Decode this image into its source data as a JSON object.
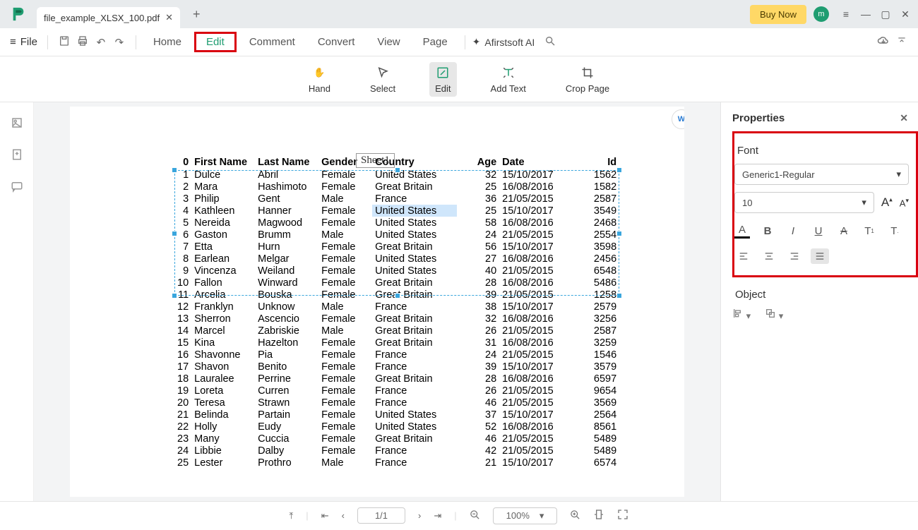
{
  "titlebar": {
    "filename": "file_example_XLSX_100.pdf",
    "buy": "Buy Now",
    "avatar": "m"
  },
  "menu": {
    "file": "File",
    "tabs": [
      "Home",
      "Edit",
      "Comment",
      "Convert",
      "View",
      "Page"
    ],
    "active": "Edit",
    "ai": "Afirstsoft AI"
  },
  "tools": {
    "hand": "Hand",
    "select": "Select",
    "edit": "Edit",
    "addtext": "Add Text",
    "croppage": "Crop Page"
  },
  "sheet_label": "Sheet1",
  "headers": [
    "",
    "First Name",
    "Last Name",
    "Gender",
    "Country",
    "Age",
    "Date",
    "Id"
  ],
  "rows": [
    [
      "0",
      "",
      "",
      "",
      "",
      "",
      "",
      ""
    ],
    [
      "1",
      "Dulce",
      "Abril",
      "Female",
      "United States",
      "32",
      "15/10/2017",
      "1562"
    ],
    [
      "2",
      "Mara",
      "Hashimoto",
      "Female",
      "Great Britain",
      "25",
      "16/08/2016",
      "1582"
    ],
    [
      "3",
      "Philip",
      "Gent",
      "Male",
      "France",
      "36",
      "21/05/2015",
      "2587"
    ],
    [
      "4",
      "Kathleen",
      "Hanner",
      "Female",
      "United States",
      "25",
      "15/10/2017",
      "3549"
    ],
    [
      "5",
      "Nereida",
      "Magwood",
      "Female",
      "United States",
      "58",
      "16/08/2016",
      "2468"
    ],
    [
      "6",
      "Gaston",
      "Brumm",
      "Male",
      "United States",
      "24",
      "21/05/2015",
      "2554"
    ],
    [
      "7",
      "Etta",
      "Hurn",
      "Female",
      "Great Britain",
      "56",
      "15/10/2017",
      "3598"
    ],
    [
      "8",
      "Earlean",
      "Melgar",
      "Female",
      "United States",
      "27",
      "16/08/2016",
      "2456"
    ],
    [
      "9",
      "Vincenza",
      "Weiland",
      "Female",
      "United States",
      "40",
      "21/05/2015",
      "6548"
    ],
    [
      "10",
      "Fallon",
      "Winward",
      "Female",
      "Great Britain",
      "28",
      "16/08/2016",
      "5486"
    ],
    [
      "11",
      "Arcelia",
      "Bouska",
      "Female",
      "Great Britain",
      "39",
      "21/05/2015",
      "1258"
    ],
    [
      "12",
      "Franklyn",
      "Unknow",
      "Male",
      "France",
      "38",
      "15/10/2017",
      "2579"
    ],
    [
      "13",
      "Sherron",
      "Ascencio",
      "Female",
      "Great Britain",
      "32",
      "16/08/2016",
      "3256"
    ],
    [
      "14",
      "Marcel",
      "Zabriskie",
      "Male",
      "Great Britain",
      "26",
      "21/05/2015",
      "2587"
    ],
    [
      "15",
      "Kina",
      "Hazelton",
      "Female",
      "Great Britain",
      "31",
      "16/08/2016",
      "3259"
    ],
    [
      "16",
      "Shavonne",
      "Pia",
      "Female",
      "France",
      "24",
      "21/05/2015",
      "1546"
    ],
    [
      "17",
      "Shavon",
      "Benito",
      "Female",
      "France",
      "39",
      "15/10/2017",
      "3579"
    ],
    [
      "18",
      "Lauralee",
      "Perrine",
      "Female",
      "Great Britain",
      "28",
      "16/08/2016",
      "6597"
    ],
    [
      "19",
      "Loreta",
      "Curren",
      "Female",
      "France",
      "26",
      "21/05/2015",
      "9654"
    ],
    [
      "20",
      "Teresa",
      "Strawn",
      "Female",
      "France",
      "46",
      "21/05/2015",
      "3569"
    ],
    [
      "21",
      "Belinda",
      "Partain",
      "Female",
      "United States",
      "37",
      "15/10/2017",
      "2564"
    ],
    [
      "22",
      "Holly",
      "Eudy",
      "Female",
      "United States",
      "52",
      "16/08/2016",
      "8561"
    ],
    [
      "23",
      "Many",
      "Cuccia",
      "Female",
      "Great Britain",
      "46",
      "21/05/2015",
      "5489"
    ],
    [
      "24",
      "Libbie",
      "Dalby",
      "Female",
      "France",
      "42",
      "21/05/2015",
      "5489"
    ],
    [
      "25",
      "Lester",
      "Prothro",
      "Male",
      "France",
      "21",
      "15/10/2017",
      "6574"
    ]
  ],
  "properties": {
    "title": "Properties",
    "font_label": "Font",
    "font_family": "Generic1-Regular",
    "font_size": "10",
    "object_label": "Object"
  },
  "footer": {
    "page": "1/1",
    "zoom": "100%"
  }
}
